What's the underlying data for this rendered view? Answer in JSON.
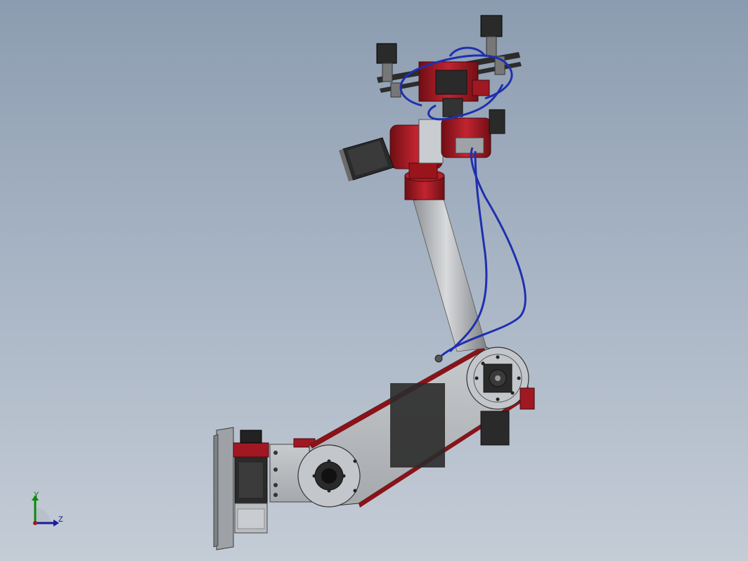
{
  "viewport": {
    "background_top": "#8c9cb0",
    "background_bottom": "#c4ccd6"
  },
  "model": {
    "colors": {
      "aluminum": "#b9bcc0",
      "red_part": "#a01822",
      "motor_black": "#2a2a2a",
      "tube_blue": "#1f2fb0"
    }
  },
  "triad": {
    "y_label": "Y",
    "z_label": "Z",
    "y_color": "#0a8a0a",
    "z_color": "#1a1aa0"
  }
}
